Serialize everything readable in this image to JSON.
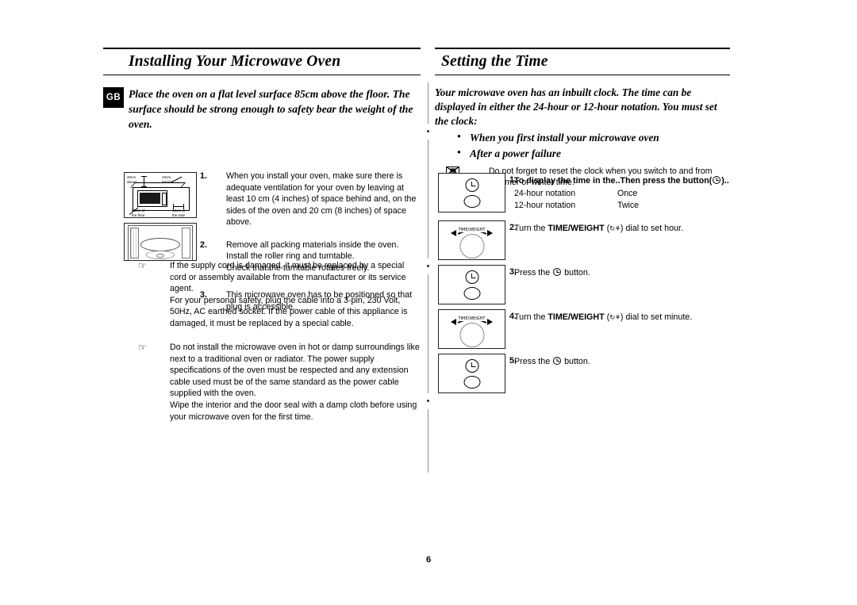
{
  "page": {
    "number": "6",
    "locale_badge": "GB"
  },
  "left": {
    "title": "Installing Your Microwave Oven",
    "lead": "Place the oven on a flat level surface 85cm above the floor. The surface should be strong enough to safety bear the weight of the oven.",
    "diagram": {
      "label_above": "20cm\nabove",
      "label_above_line1": "20cm",
      "label_above_line2": "above",
      "label_behind_line1": "10cm",
      "label_behind_line2": "behind",
      "label_floor_line1": "85cm of",
      "label_floor_line2": "the floor",
      "label_side_line1": "10cm or",
      "label_side_line2": "the side"
    },
    "steps": [
      {
        "num": "1.",
        "text": "When you install your oven, make sure there is adequate ventilation for your oven by leaving at least 10 cm (4 inches) of space behind and, on the sides of the oven and 20 cm (8 inches) of space above."
      },
      {
        "num": "2.",
        "line1": "Remove all packing materials inside the oven.",
        "line2": "Install the roller ring and turntable.",
        "line3": "Check that the turntable rotates freely."
      },
      {
        "num": "3.",
        "text": "This microwave oven has to be positioned so that plug is accessible."
      }
    ],
    "notes": [
      {
        "icon": "pointing-hand-icon",
        "line1": "If the supply cord is damaged, it must be replaced by a special cord or assembly available from the manufacturer or its service agent.",
        "line2": "For your personal safety, plug the cable into a 3-pin, 230 Volt, 50Hz, AC earthed socket. If the power cable of this appliance is damaged, it must be replaced by a special cable."
      },
      {
        "icon": "pointing-hand-icon",
        "line1": "Do not install the microwave oven in hot or damp surroundings like next to a traditional oven or radiator. The power supply specifications of the oven must be respected and any extension cable used must be of the same standard as the power cable supplied with the oven.",
        "line2": "Wipe the interior and the door seal with a damp cloth before using your microwave oven for the first time."
      }
    ]
  },
  "right": {
    "title": "Setting the Time",
    "lead": "Your microwave oven has an inbuilt clock. The time can be displayed in either the 24-hour or 12-hour notation. You must set the clock:",
    "bullets": [
      "When you first install your microwave oven",
      "After a power failure"
    ],
    "note": {
      "icon": "envelope-note-icon",
      "text": "Do not forget to reset the clock when you switch to and from summer or winter time."
    },
    "steps": [
      {
        "num": "1.",
        "art": "clock-button-panel",
        "heading_a": "To display the time in the..",
        "heading_b": "Then press the button(",
        "heading_c": ")..",
        "table": [
          {
            "notation": "24-hour notation",
            "presses": "Once"
          },
          {
            "notation": "12-hour notation",
            "presses": "Twice"
          }
        ]
      },
      {
        "num": "2.",
        "art": "time-weight-dial",
        "text_a": "Turn the ",
        "text_bold": "TIME/WEIGHT",
        "text_b": " (",
        "text_c": ") dial to set hour.",
        "dial_tag": "TIME/WEIGHT"
      },
      {
        "num": "3.",
        "art": "clock-button-panel",
        "text_a": "Press the ",
        "text_c": " button."
      },
      {
        "num": "4.",
        "art": "time-weight-dial",
        "text_a": "Turn the ",
        "text_bold": "TIME/WEIGHT",
        "text_b": " (",
        "text_c": ") dial to set minute.",
        "dial_tag": "TIME/WEIGHT"
      },
      {
        "num": "5.",
        "art": "clock-button-panel",
        "text_a": "Press the ",
        "text_c": " button."
      }
    ]
  }
}
